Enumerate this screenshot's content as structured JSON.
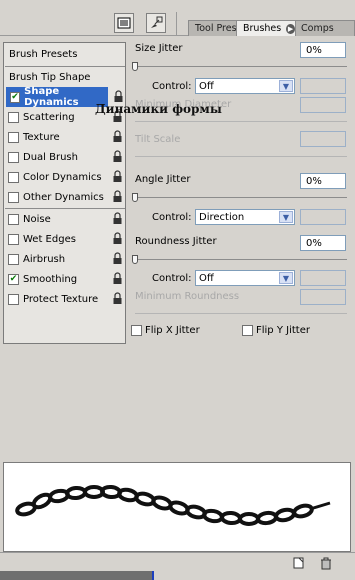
{
  "tabs": {
    "tool_presets": "Tool Prese",
    "brushes": "Brushes",
    "comps": "Comps"
  },
  "left_list": {
    "brush_presets": "Brush Presets",
    "brush_tip_shape": "Brush Tip Shape",
    "options": [
      {
        "label": "Shape Dynamics",
        "checked": true,
        "selected": true
      },
      {
        "label": "Scattering",
        "checked": false
      },
      {
        "label": "Texture",
        "checked": false
      },
      {
        "label": "Dual Brush",
        "checked": false
      },
      {
        "label": "Color Dynamics",
        "checked": false
      },
      {
        "label": "Other Dynamics",
        "checked": false
      },
      {
        "label": "Noise",
        "checked": false
      },
      {
        "label": "Wet Edges",
        "checked": false
      },
      {
        "label": "Airbrush",
        "checked": false
      },
      {
        "label": "Smoothing",
        "checked": true
      },
      {
        "label": "Protect Texture",
        "checked": false
      }
    ]
  },
  "overlay_caption": "Динамики формы",
  "settings": {
    "size_jitter_label": "Size Jitter",
    "size_jitter_value": "0%",
    "control_label": "Control:",
    "size_control": "Off",
    "minimum_diameter_label": "Minimum Diameter",
    "tilt_scale_label": "Tilt Scale",
    "angle_jitter_label": "Angle Jitter",
    "angle_jitter_value": "0%",
    "angle_control": "Direction",
    "roundness_jitter_label": "Roundness Jitter",
    "roundness_jitter_value": "0%",
    "roundness_control": "Off",
    "minimum_roundness_label": "Minimum Roundness",
    "flip_x_label": "Flip X Jitter",
    "flip_y_label": "Flip Y Jitter"
  },
  "colors": {
    "selection": "#3169c6",
    "checkmark": "#0a7a0a",
    "panel_bg": "#d6d3ce"
  }
}
